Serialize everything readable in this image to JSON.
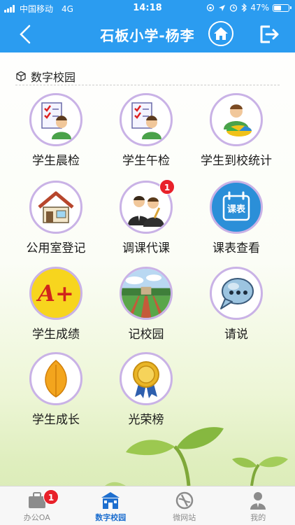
{
  "status_bar": {
    "carrier": "中国移动",
    "network": "4G",
    "time": "14:18",
    "battery": "47%",
    "battery_level": 0.47
  },
  "header": {
    "title": "石板小学-杨李",
    "back_icon": "chevron-left-icon",
    "home_icon": "home-icon",
    "logout_icon": "logout-icon"
  },
  "section": {
    "title": "数字校园",
    "icon": "cube-icon"
  },
  "grid": [
    {
      "label": "学生晨检",
      "icon": "checklist-student-icon",
      "badge": ""
    },
    {
      "label": "学生午检",
      "icon": "checklist-student-icon",
      "badge": ""
    },
    {
      "label": "学生到校统计",
      "icon": "student-pie-chart-icon",
      "badge": ""
    },
    {
      "label": "公用室登记",
      "icon": "house-icon",
      "badge": ""
    },
    {
      "label": "调课代课",
      "icon": "teachers-icon",
      "badge": "1"
    },
    {
      "label": "课表查看",
      "icon": "calendar-icon",
      "badge": ""
    },
    {
      "label": "学生成绩",
      "icon": "grade-a-plus-icon",
      "badge": ""
    },
    {
      "label": "记校园",
      "icon": "campus-photo-icon",
      "badge": ""
    },
    {
      "label": "请说",
      "icon": "speech-bubble-icon",
      "badge": ""
    },
    {
      "label": "学生成长",
      "icon": "leaf-icon",
      "badge": ""
    },
    {
      "label": "光荣榜",
      "icon": "medal-icon",
      "badge": ""
    }
  ],
  "calendar_icon_text": "课表",
  "grade_icon_text": "A+",
  "tabs": [
    {
      "label": "办公OA",
      "icon": "briefcase-icon",
      "badge": "1",
      "active": false
    },
    {
      "label": "数字校园",
      "icon": "school-icon",
      "badge": "",
      "active": true
    },
    {
      "label": "微网站",
      "icon": "compass-icon",
      "badge": "",
      "active": false
    },
    {
      "label": "我的",
      "icon": "person-icon",
      "badge": "",
      "active": false
    }
  ],
  "colors": {
    "primary": "#2b9cf0",
    "badge": "#e8212a",
    "tab_active": "#1e6fcf",
    "icon_ring": "#c9b2e6"
  }
}
